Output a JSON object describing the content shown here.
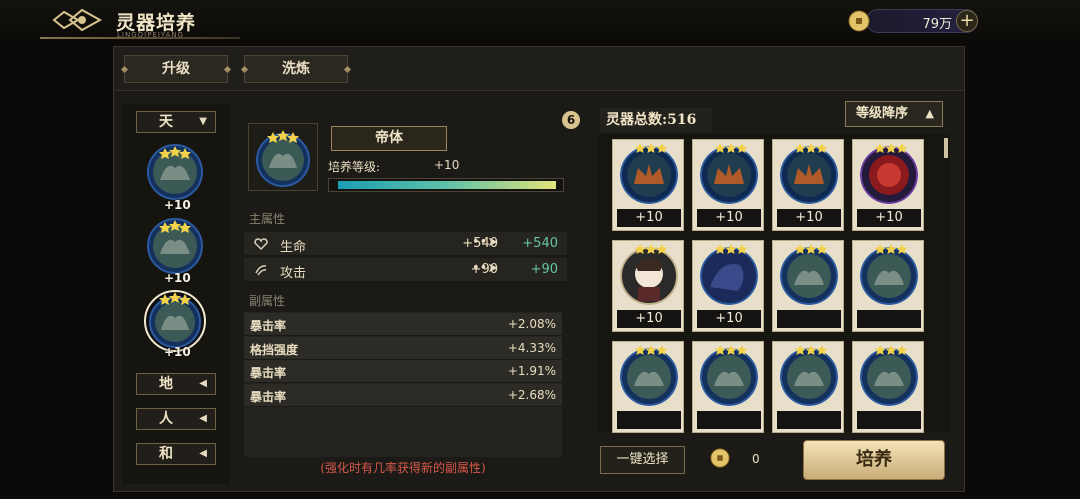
{
  "header": {
    "title": "灵器培养",
    "subtitle": "LINGQIPEIYANG",
    "currency_amount": "79万",
    "add_symbol": "+"
  },
  "tabs": [
    {
      "label": "升级"
    },
    {
      "label": "洗炼"
    }
  ],
  "categories": {
    "selected": {
      "label": "天"
    },
    "others": [
      {
        "label": "地"
      },
      {
        "label": "人"
      },
      {
        "label": "和"
      }
    ],
    "equipped": [
      {
        "plus": "+10"
      },
      {
        "plus": "+10"
      },
      {
        "plus": "+10"
      }
    ]
  },
  "detail": {
    "name": "帝体",
    "level_label": "培养等级:",
    "level_value": "+10",
    "level_progress": 1.0,
    "help_icon": "6",
    "main_section": "主属性",
    "main_attrs": [
      {
        "name": "生命",
        "from": "+540",
        "to": "+540",
        "icon": "heart-icon"
      },
      {
        "name": "攻击",
        "from": "+90",
        "to": "+90",
        "icon": "claw-icon"
      }
    ],
    "sub_section": "副属性",
    "sub_attrs": [
      {
        "name": "暴击率",
        "value": "+2.08%"
      },
      {
        "name": "格挡强度",
        "value": "+4.33%"
      },
      {
        "name": "暴击率",
        "value": "+1.91%"
      },
      {
        "name": "暴击率",
        "value": "+2.68%"
      }
    ],
    "hint": "(强化时有几率获得新的副属性)"
  },
  "inventory": {
    "total_label": "灵器总数:516",
    "sort_label": "等级降序",
    "items": [
      {
        "level": "+10",
        "kind": "crown"
      },
      {
        "level": "+10",
        "kind": "crown"
      },
      {
        "level": "+10",
        "kind": "crown"
      },
      {
        "level": "+10",
        "kind": "red"
      },
      {
        "level": "+10",
        "kind": "girl"
      },
      {
        "level": "+10",
        "kind": "dragon"
      },
      {
        "level": "",
        "kind": "bird"
      },
      {
        "level": "",
        "kind": "bird"
      },
      {
        "level": "",
        "kind": "bird"
      },
      {
        "level": "",
        "kind": "bird"
      },
      {
        "level": "",
        "kind": "bird"
      },
      {
        "level": "",
        "kind": "bird"
      }
    ]
  },
  "bottom": {
    "select_label": "一键选择",
    "cost_value": "0",
    "cultivate_label": "培养"
  },
  "colors": {
    "accent": "#cfb27a",
    "arrow_green": "#66c7a0",
    "hint_red": "#d8584a"
  }
}
